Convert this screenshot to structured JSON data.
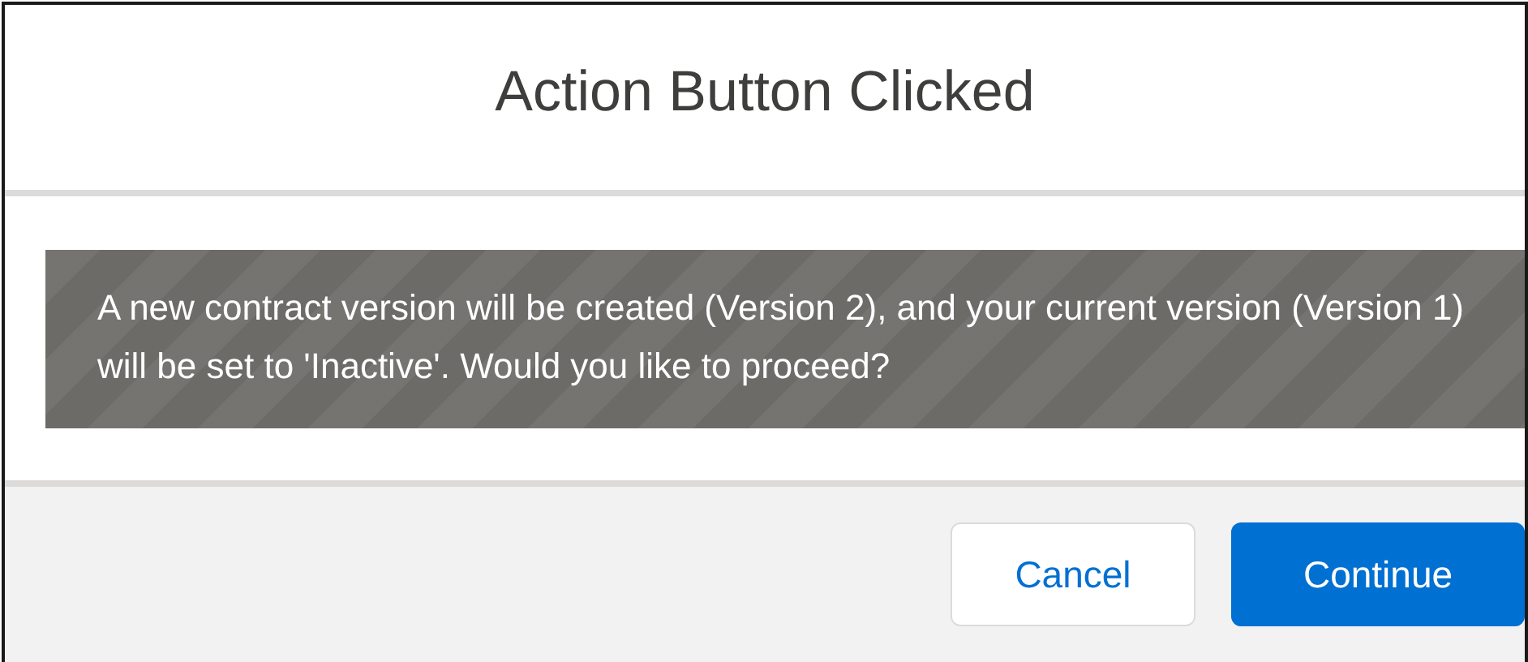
{
  "dialog": {
    "title": "Action Button Clicked",
    "message": "A new contract version will be created (Version 2), and your current version (Version 1) will be set to 'Inactive'. Would you like to proceed?",
    "buttons": [
      {
        "label": "Cancel",
        "kind": "neutral"
      },
      {
        "label": "Continue",
        "kind": "brand"
      }
    ]
  }
}
